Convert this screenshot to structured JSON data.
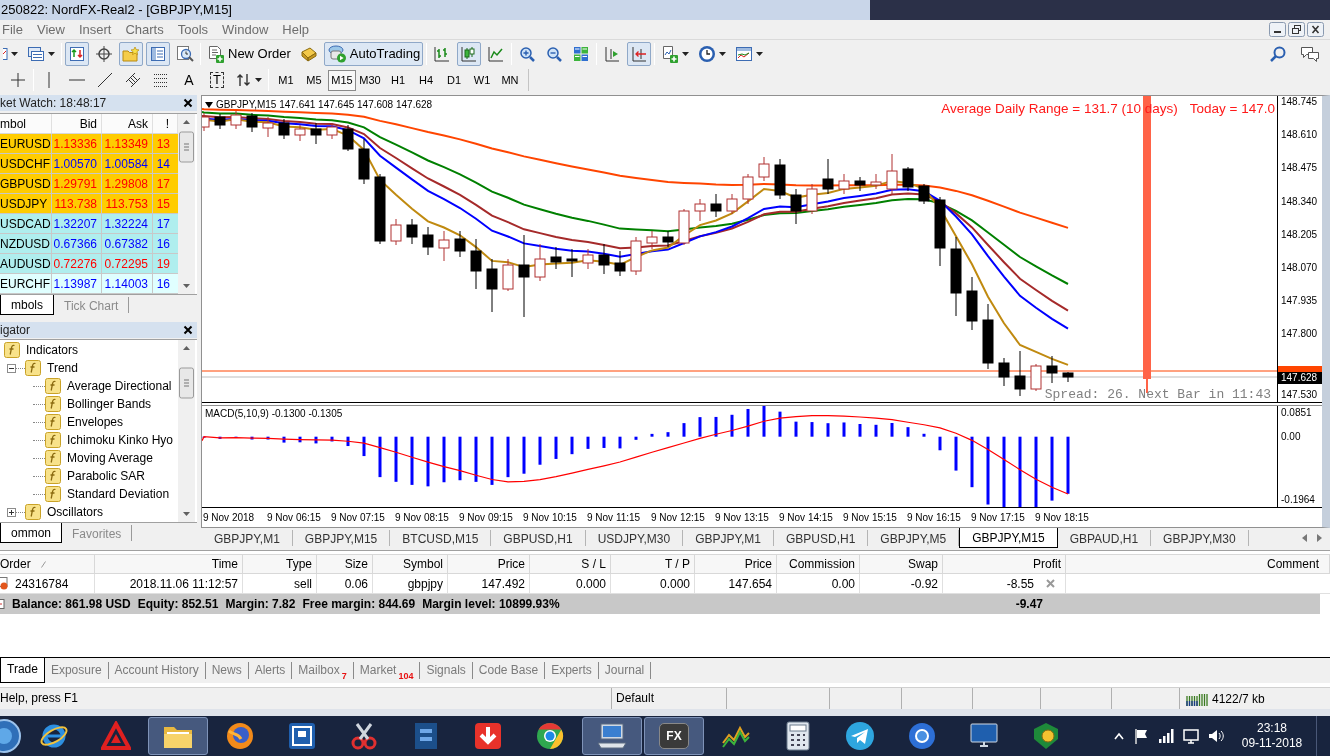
{
  "window": {
    "title": "250822: NordFX-Real2 - [GBPJPY,M15]"
  },
  "menu": [
    "File",
    "View",
    "Insert",
    "Charts",
    "Tools",
    "Window",
    "Help"
  ],
  "toolbar": [
    [
      {
        "kind": "new-chart",
        "dropdown": true,
        "on": false
      },
      {
        "kind": "profiles",
        "dropdown": true,
        "on": false
      }
    ],
    [
      {
        "kind": "market-watch",
        "on": true
      },
      {
        "kind": "data-window",
        "on": false
      },
      {
        "kind": "navigator",
        "on": true
      },
      {
        "kind": "terminal",
        "on": true
      },
      {
        "kind": "tester",
        "on": false
      }
    ],
    [
      {
        "kind": "new-order",
        "label": "New Order",
        "on": false
      },
      {
        "kind": "editor",
        "on": false
      },
      {
        "kind": "autotrading",
        "label": "AutoTrading",
        "on": true
      }
    ],
    [
      {
        "kind": "bar-chart",
        "on": false
      },
      {
        "kind": "candlesticks",
        "on": true
      },
      {
        "kind": "line-chart",
        "on": false
      }
    ],
    [
      {
        "kind": "zoom-in",
        "on": false
      },
      {
        "kind": "zoom-out",
        "on": false
      },
      {
        "kind": "tile",
        "on": false
      }
    ],
    [
      {
        "kind": "chart-shift",
        "on": false
      },
      {
        "kind": "auto-scroll",
        "on": true
      }
    ],
    [
      {
        "kind": "indicators",
        "dropdown": true,
        "on": false
      },
      {
        "kind": "periods",
        "dropdown": true,
        "on": false
      },
      {
        "kind": "templates",
        "dropdown": true,
        "on": false
      }
    ]
  ],
  "drawing_tools": [
    [
      {
        "kind": "crosshair",
        "on": false
      }
    ],
    [
      {
        "kind": "vertical-line",
        "on": false
      },
      {
        "kind": "horizontal-line",
        "on": false
      },
      {
        "kind": "trendline",
        "on": false
      },
      {
        "kind": "channel",
        "on": false
      },
      {
        "kind": "fibonacci",
        "on": false
      },
      {
        "kind": "text",
        "label": "A",
        "on": false
      },
      {
        "kind": "text-label",
        "label": "T",
        "on": false
      },
      {
        "kind": "arrows",
        "dropdown": true,
        "on": false
      }
    ]
  ],
  "periods": [
    {
      "label": "M1",
      "selected": false
    },
    {
      "label": "M5",
      "selected": false
    },
    {
      "label": "M15",
      "selected": true
    },
    {
      "label": "M30",
      "selected": false
    },
    {
      "label": "H1",
      "selected": false
    },
    {
      "label": "H4",
      "selected": false
    },
    {
      "label": "D1",
      "selected": false
    },
    {
      "label": "W1",
      "selected": false
    },
    {
      "label": "MN",
      "selected": false
    }
  ],
  "market_watch": {
    "title": "ket Watch: 18:48:17",
    "columns": [
      "mbol",
      "Bid",
      "Ask",
      "!"
    ],
    "rows": [
      {
        "symbol": "EURUSD",
        "bid": "1.13336",
        "ask": "1.13349",
        "spread": "13",
        "rising": false,
        "color": "#ffcc00"
      },
      {
        "symbol": "USDCHF",
        "bid": "1.00570",
        "ask": "1.00584",
        "spread": "14",
        "rising": true,
        "color": "#ffcc00"
      },
      {
        "symbol": "GBPUSD",
        "bid": "1.29791",
        "ask": "1.29808",
        "spread": "17",
        "rising": false,
        "color": "#ffcc00"
      },
      {
        "symbol": "USDJPY",
        "bid": "113.738",
        "ask": "113.753",
        "spread": "15",
        "rising": false,
        "color": "#ffcc00"
      },
      {
        "symbol": "USDCAD",
        "bid": "1.32207",
        "ask": "1.32224",
        "spread": "17",
        "rising": true,
        "color": "#afeeee"
      },
      {
        "symbol": "NZDUSD",
        "bid": "0.67366",
        "ask": "0.67382",
        "spread": "16",
        "rising": true,
        "color": "#afeeee"
      },
      {
        "symbol": "AUDUSD",
        "bid": "0.72276",
        "ask": "0.72295",
        "spread": "19",
        "rising": false,
        "color": "#afeeee"
      },
      {
        "symbol": "EURCHF",
        "bid": "1.13987",
        "ask": "1.14003",
        "spread": "16",
        "rising": true,
        "color": "#e0ffff"
      }
    ],
    "tabs": [
      {
        "label": "mbols",
        "selected": true
      },
      {
        "label": "Tick Chart",
        "selected": false
      }
    ]
  },
  "navigator": {
    "title": "igator",
    "tree": [
      {
        "label": "Indicators",
        "children": [
          {
            "label": "Trend",
            "expanded": true,
            "children": [
              {
                "label": "Average Directional"
              },
              {
                "label": "Bollinger Bands"
              },
              {
                "label": "Envelopes"
              },
              {
                "label": "Ichimoku Kinko Hyo"
              },
              {
                "label": "Moving Average"
              },
              {
                "label": "Parabolic SAR"
              },
              {
                "label": "Standard Deviation"
              }
            ]
          },
          {
            "label": "Oscillators",
            "expanded": false
          }
        ]
      }
    ],
    "tabs": [
      {
        "label": "ommon",
        "selected": true
      },
      {
        "label": "Favorites",
        "selected": false
      }
    ]
  },
  "chart": {
    "header": "GBPJPY,M15 147.641 147.645 147.608 147.628",
    "daily_range": "Average Daily Range = 131.7 (10 days)",
    "today": "Today = 147.0",
    "spread_info": "Spread: 26. Next Bar in 11:43",
    "price_axis": [
      "148.745",
      "148.610",
      "148.475",
      "148.340",
      "148.205",
      "148.070",
      "147.935",
      "147.800",
      "147.530"
    ],
    "current_price": "147.628",
    "macd": {
      "label": "MACD(5,10,9) -0.1300 -0.1305",
      "axis": [
        "0.0851",
        "0.00",
        "-0.1964"
      ]
    },
    "time_axis": [
      "9 Nov 2018",
      "9 Nov 06:15",
      "9 Nov 07:15",
      "9 Nov 08:15",
      "9 Nov 09:15",
      "9 Nov 10:15",
      "9 Nov 11:15",
      "9 Nov 12:15",
      "9 Nov 13:15",
      "9 Nov 14:15",
      "9 Nov 15:15",
      "9 Nov 16:15",
      "9 Nov 17:15",
      "9 Nov 18:15"
    ]
  },
  "chart_tabs": [
    {
      "label": "GBPJPY,M1",
      "selected": false
    },
    {
      "label": "GBPJPY,M15",
      "selected": false
    },
    {
      "label": "BTCUSD,M15",
      "selected": false
    },
    {
      "label": "GBPUSD,H1",
      "selected": false
    },
    {
      "label": "USDJPY,M30",
      "selected": false
    },
    {
      "label": "GBPJPY,M1",
      "selected": false
    },
    {
      "label": "GBPUSD,H1",
      "selected": false
    },
    {
      "label": "GBPJPY,M5",
      "selected": false
    },
    {
      "label": "GBPJPY,M15",
      "selected": true
    },
    {
      "label": "GBPAUD,H1",
      "selected": false
    },
    {
      "label": "GBPJPY,M30",
      "selected": false
    }
  ],
  "terminal": {
    "columns": [
      "Order",
      "Time",
      "Type",
      "Size",
      "Symbol",
      "Price",
      "S / L",
      "T / P",
      "Price",
      "Commission",
      "Swap",
      "Profit",
      "Comment"
    ],
    "rows": [
      {
        "cells": [
          "24316784",
          "2018.11.06 11:12:57",
          "sell",
          "0.06",
          "gbpjpy",
          "147.492",
          "0.000",
          "0.000",
          "147.654",
          "0.00",
          "-0.92",
          "-8.55"
        ]
      }
    ],
    "summary": [
      "Balance: 861.98 USD",
      "Equity: 852.51",
      "Margin: 7.82",
      "Free margin: 844.69",
      "Margin level: 10899.93%"
    ],
    "total_profit": "-9.47",
    "tabs": [
      {
        "label": "Trade",
        "selected": true
      },
      {
        "label": "Exposure",
        "selected": false
      },
      {
        "label": "Account History",
        "selected": false
      },
      {
        "label": "News",
        "selected": false
      },
      {
        "label": "Alerts",
        "selected": false
      },
      {
        "label": "Mailbox",
        "badge": "7",
        "selected": false
      },
      {
        "label": "Market",
        "badge": "104",
        "selected": false
      },
      {
        "label": "Signals",
        "selected": false
      },
      {
        "label": "Code Base",
        "selected": false
      },
      {
        "label": "Experts",
        "selected": false
      },
      {
        "label": "Journal",
        "selected": false
      }
    ]
  },
  "status_bar": {
    "help": "Help, press F1",
    "profile": "Default",
    "traffic": "4122/7 kb"
  },
  "taskbar": {
    "apps": [
      {
        "kind": "ie",
        "open": false
      },
      {
        "kind": "red-triangle",
        "open": false
      },
      {
        "kind": "explorer",
        "open": true
      },
      {
        "kind": "firefox",
        "open": false
      },
      {
        "kind": "blue-tile",
        "open": false
      },
      {
        "kind": "scissors",
        "open": false
      },
      {
        "kind": "blue-book",
        "open": false
      },
      {
        "kind": "download",
        "open": false
      },
      {
        "kind": "chrome",
        "open": false
      },
      {
        "kind": "computer",
        "open": true
      },
      {
        "kind": "fx",
        "label": "FX",
        "open": true
      },
      {
        "kind": "zigzag",
        "open": false
      },
      {
        "kind": "calculator",
        "open": false
      },
      {
        "kind": "telegram",
        "open": false
      },
      {
        "kind": "blue-circle",
        "open": false
      },
      {
        "kind": "monitor",
        "open": false
      },
      {
        "kind": "green-tag",
        "open": false
      }
    ],
    "time": "23:18",
    "date": "09-11-2018"
  }
}
